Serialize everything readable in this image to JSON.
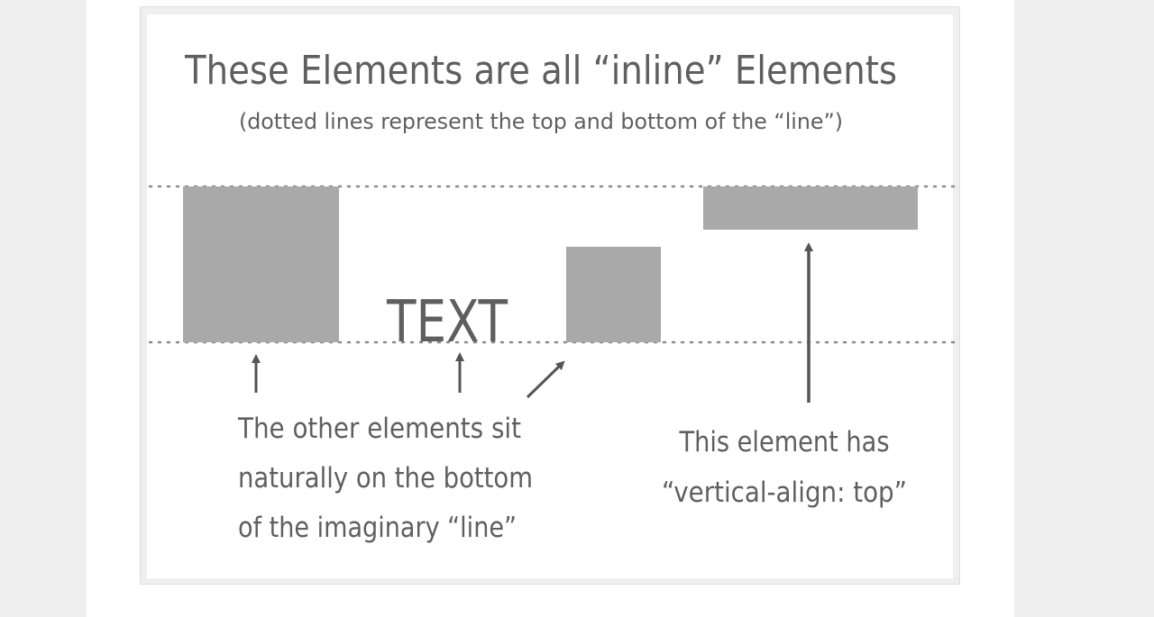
{
  "diagram": {
    "title": "These Elements are all “inline” Elements",
    "subtitle": "(dotted lines represent the top and bottom of the “line”)",
    "inline_text": "TEXT",
    "left_caption": [
      "The other elements sit",
      "naturally on the bottom",
      "of the imaginary “line”"
    ],
    "right_caption": [
      "This element has",
      "“vertical-align: top”"
    ]
  },
  "colors": {
    "page_background": "#efefef",
    "text": "#5f5f5f",
    "box_fill": "#a9a9a9",
    "dotted_line": "#8a8a8a",
    "arrow": "#555555"
  }
}
